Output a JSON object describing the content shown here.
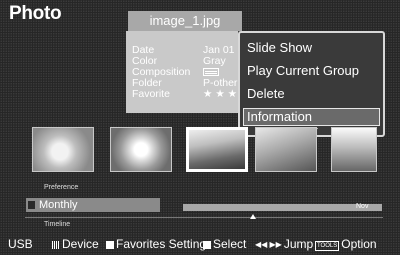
{
  "app": {
    "title": "Photo",
    "file_name": "image_1.jpg"
  },
  "info_panel": {
    "rows": [
      {
        "label": "Date",
        "value": "Jan 01 :"
      },
      {
        "label": "Color",
        "value": "Gray"
      },
      {
        "label": "Composition",
        "value": ""
      },
      {
        "label": "Folder",
        "value": "P-other"
      },
      {
        "label": "Favorite",
        "value": "★ ★ ★"
      }
    ]
  },
  "context_menu": {
    "items": [
      {
        "label": "Slide Show"
      },
      {
        "label": "Play Current Group"
      },
      {
        "label": "Delete"
      },
      {
        "label": "Information"
      }
    ],
    "selected_item": "Information"
  },
  "thumbnails": [
    {
      "name": "photo-1"
    },
    {
      "name": "photo-2"
    },
    {
      "name": "photo-3",
      "selected": true
    },
    {
      "name": "photo-4"
    },
    {
      "name": "photo-5"
    }
  ],
  "preference": {
    "label": "Preference",
    "value": "Monthly"
  },
  "timeline": {
    "label": "Timeline",
    "month": "Nov"
  },
  "statusbar": {
    "usb": "USB",
    "device": "Device",
    "favorites": "Favorites Setting",
    "select": "Select",
    "jump_arrows": "◀◀ ▶▶",
    "jump": "Jump",
    "tools": "TOOLS",
    "option": "Option"
  }
}
